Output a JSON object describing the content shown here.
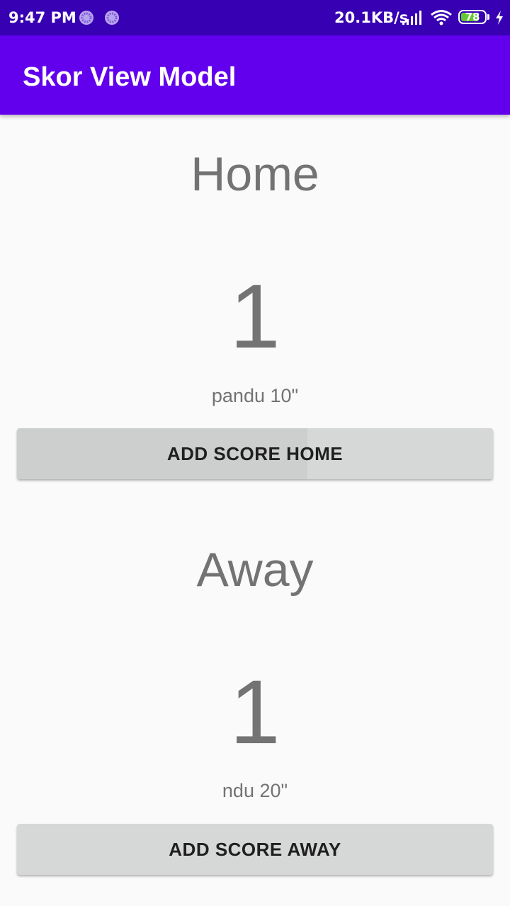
{
  "status_bar": {
    "time": "9:47 PM",
    "speed": "20.1KB/s",
    "battery_level": "78",
    "battery_fraction": 0.78,
    "icons": [
      "notification-icon",
      "notification-icon",
      "signal-icon",
      "wifi-icon",
      "battery-icon",
      "charging-icon"
    ]
  },
  "app_bar": {
    "title": "Skor View Model"
  },
  "home": {
    "label": "Home",
    "score": "1",
    "scorer": "pandu 10\"",
    "button_label": "ADD SCORE HOME"
  },
  "away": {
    "label": "Away",
    "score": "1",
    "scorer": "ndu 20\"",
    "button_label": "ADD SCORE AWAY"
  },
  "colors": {
    "status_bar": "#3700b3",
    "app_bar": "#6200ee",
    "background": "#fafafa",
    "text": "#737373",
    "button": "#d6d7d7",
    "button_text": "#1f1f1f",
    "battery": "#64c832"
  }
}
